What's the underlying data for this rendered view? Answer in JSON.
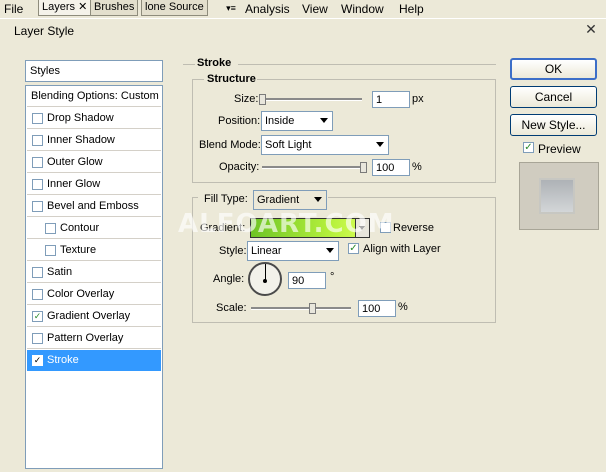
{
  "menubar": {
    "file": "File",
    "tabs": [
      "Layers",
      "Brushes",
      "lone Source"
    ],
    "menus": [
      "Analysis",
      "View",
      "Window",
      "Help"
    ]
  },
  "dialog": {
    "title": "Layer Style",
    "close": "✕"
  },
  "left": {
    "styles": "Styles",
    "blending": "Blending Options: Custom",
    "items": [
      {
        "label": "Drop Shadow",
        "checked": false
      },
      {
        "label": "Inner Shadow",
        "checked": false
      },
      {
        "label": "Outer Glow",
        "checked": false
      },
      {
        "label": "Inner Glow",
        "checked": false
      },
      {
        "label": "Bevel and Emboss",
        "checked": false
      },
      {
        "label": "Contour",
        "checked": false
      },
      {
        "label": "Texture",
        "checked": false
      },
      {
        "label": "Satin",
        "checked": false
      },
      {
        "label": "Color Overlay",
        "checked": false
      },
      {
        "label": "Gradient Overlay",
        "checked": true
      },
      {
        "label": "Pattern Overlay",
        "checked": false
      },
      {
        "label": "Stroke",
        "checked": true
      }
    ]
  },
  "stroke": {
    "title": "Stroke",
    "structure": "Structure",
    "size_label": "Size:",
    "size_value": "1",
    "size_unit": "px",
    "position_label": "Position:",
    "position_value": "Inside",
    "blend_label": "Blend Mode:",
    "blend_value": "Soft Light",
    "opacity_label": "Opacity:",
    "opacity_value": "100",
    "opacity_unit": "%",
    "size_slider_level": 0.0,
    "opacity_slider_level": 1.0
  },
  "fill": {
    "type_label": "Fill Type:",
    "type_value": "Gradient",
    "gradient_label": "Gradient:",
    "reverse_label": "Reverse",
    "reverse_checked": false,
    "style_label": "Style:",
    "style_value": "Linear",
    "align_label": "Align with Layer",
    "align_checked": true,
    "angle_label": "Angle:",
    "angle_value": "90",
    "angle_unit": "°",
    "scale_label": "Scale:",
    "scale_value": "100",
    "scale_unit": "%",
    "scale_slider_level": 0.5
  },
  "buttons": {
    "ok": "OK",
    "cancel": "Cancel",
    "new_style": "New Style...",
    "preview_label": "Preview",
    "preview_checked": true
  },
  "watermark": "ALFOART.COM",
  "colors": {
    "selection": "#3399ff",
    "gradient_start": "#6ec425",
    "gradient_end": "#d9ff5a"
  }
}
